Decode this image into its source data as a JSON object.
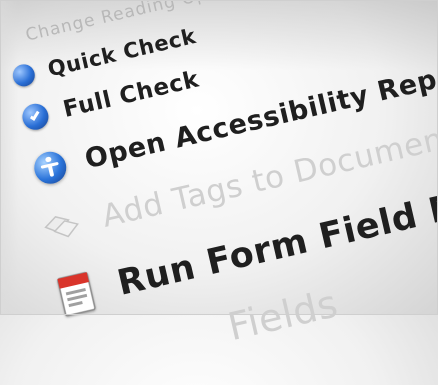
{
  "menu": {
    "heading": "Change Reading Options",
    "items": [
      {
        "label": "Quick Check",
        "icon": "blue-dot-icon"
      },
      {
        "label": "Full Check",
        "icon": "checkmark-icon"
      },
      {
        "label": "Open Accessibility Report",
        "icon": "accessibility-icon"
      },
      {
        "label": "Add Tags to Document",
        "icon": "tags-icon",
        "disabled": true
      },
      {
        "label": "Run Form Field Recognition",
        "icon": "document-icon"
      },
      {
        "label": "Fields",
        "icon": "",
        "disabled": true
      }
    ]
  },
  "colors": {
    "text": "#1f1f1f",
    "heading": "#b8b8b8",
    "disabled": "#cfcfcf",
    "icon_blue": "#2a6fd6"
  }
}
